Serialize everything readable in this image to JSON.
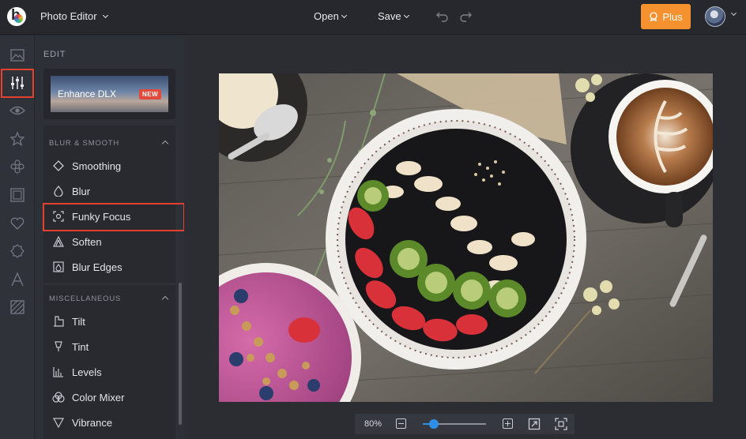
{
  "app": {
    "title": "Photo Editor"
  },
  "topbar": {
    "open_label": "Open",
    "save_label": "Save",
    "plus_label": "Plus",
    "accent_color": "#f5922f"
  },
  "rail": {
    "items": [
      {
        "icon": "image-icon"
      },
      {
        "icon": "sliders-icon",
        "active": true
      },
      {
        "icon": "eye-icon"
      },
      {
        "icon": "star-icon"
      },
      {
        "icon": "flower-icon"
      },
      {
        "icon": "frame-icon"
      },
      {
        "icon": "heart-icon"
      },
      {
        "icon": "badge-icon"
      },
      {
        "icon": "text-icon"
      },
      {
        "icon": "texture-icon"
      }
    ]
  },
  "panel": {
    "heading": "EDIT",
    "enhance": {
      "label": "Enhance DLX",
      "badge": "NEW"
    },
    "sections": [
      {
        "header": "BLUR & SMOOTH",
        "tools": [
          {
            "label": "Smoothing",
            "icon": "diamond-icon"
          },
          {
            "label": "Blur",
            "icon": "drop-icon"
          },
          {
            "label": "Funky Focus",
            "icon": "focus-icon",
            "highlighted": true
          },
          {
            "label": "Soften",
            "icon": "soften-icon"
          },
          {
            "label": "Blur Edges",
            "icon": "blur-edges-icon"
          }
        ]
      },
      {
        "header": "MISCELLANEOUS",
        "tools": [
          {
            "label": "Tilt",
            "icon": "tilt-icon"
          },
          {
            "label": "Tint",
            "icon": "tint-icon"
          },
          {
            "label": "Levels",
            "icon": "levels-icon"
          },
          {
            "label": "Color Mixer",
            "icon": "color-mixer-icon"
          },
          {
            "label": "Vibrance",
            "icon": "vibrance-icon"
          }
        ]
      }
    ]
  },
  "zoom": {
    "level_label": "80%",
    "slider_fraction": 0.17
  }
}
